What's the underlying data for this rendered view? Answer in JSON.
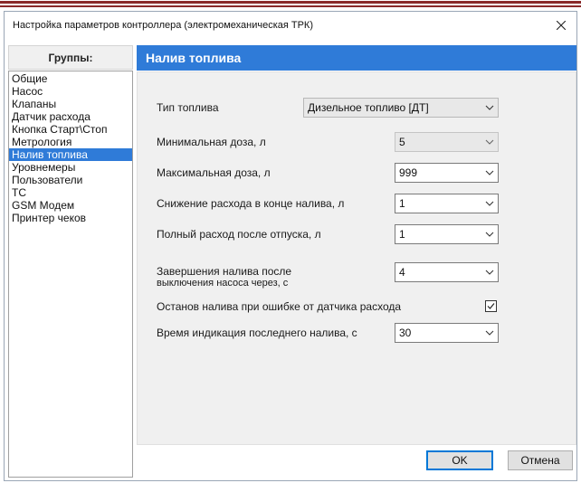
{
  "window": {
    "title": "Настройка параметров контроллера (электромеханическая ТРК)"
  },
  "groups": {
    "header": "Группы:",
    "items": [
      {
        "label": "Общие",
        "selected": false
      },
      {
        "label": "Насос",
        "selected": false
      },
      {
        "label": "Клапаны",
        "selected": false
      },
      {
        "label": "Датчик расхода",
        "selected": false
      },
      {
        "label": "Кнопка Старт\\Стоп",
        "selected": false
      },
      {
        "label": "Метрология",
        "selected": false
      },
      {
        "label": "Налив топлива",
        "selected": true
      },
      {
        "label": "Уровнемеры",
        "selected": false
      },
      {
        "label": "Пользователи",
        "selected": false
      },
      {
        "label": "ТС",
        "selected": false
      },
      {
        "label": "GSM Модем",
        "selected": false
      },
      {
        "label": "Принтер чеков",
        "selected": false
      }
    ]
  },
  "panel": {
    "title": "Налив топлива",
    "fields": {
      "fuel_type": {
        "label": "Тип топлива",
        "value": "Дизельное топливо [ДТ]"
      },
      "min_dose": {
        "label": "Минимальная доза, л",
        "value": "5"
      },
      "max_dose": {
        "label": "Максимальная доза, л",
        "value": "999"
      },
      "flow_reduction": {
        "label": "Снижение расхода в конце налива, л",
        "value": "1"
      },
      "full_flow": {
        "label": "Полный расход после отпуска, л",
        "value": "1"
      },
      "finish_after_pump_off": {
        "label_line1": "Завершения налива после",
        "label_line2": "выключения насоса через, с",
        "value": "4"
      },
      "stop_on_sensor_error": {
        "label": "Останов налива при ошибке от датчика расхода",
        "checked": true
      },
      "last_fill_display_time": {
        "label": "Время индикация последнего налива, с",
        "value": "30"
      }
    }
  },
  "buttons": {
    "ok": "OK",
    "cancel": "Отмена"
  },
  "colors": {
    "accent": "#2f7bd8",
    "top_stripe": "#8a2a2a"
  }
}
